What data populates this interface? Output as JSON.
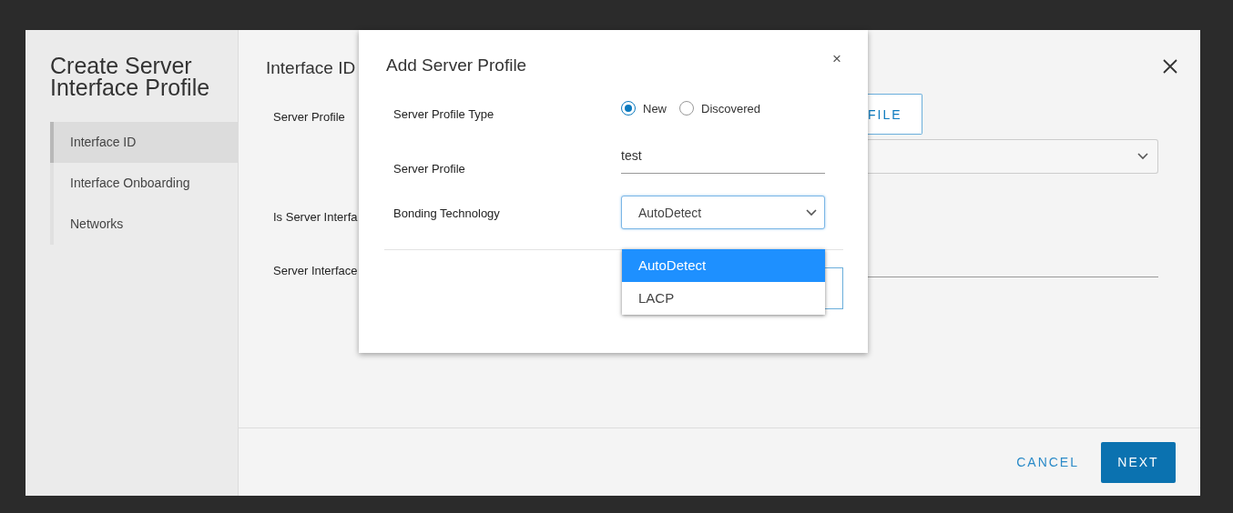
{
  "wizard": {
    "title": "Create Server Interface Profile",
    "steps": [
      {
        "label": "Interface ID",
        "selected": true
      },
      {
        "label": "Interface Onboarding",
        "selected": false
      },
      {
        "label": "Networks",
        "selected": false
      }
    ]
  },
  "form": {
    "title": "Interface ID",
    "server_profile": {
      "label": "Server Profile",
      "button": "FILE"
    },
    "discovered": {
      "label": "Is Server Interfa"
    },
    "interface_id": {
      "label": "Server Interface"
    }
  },
  "footer": {
    "cancel": "CANCEL",
    "next": "NEXT"
  },
  "dialog": {
    "title": "Add Server Profile",
    "close": "×",
    "type": {
      "label": "Server Profile Type",
      "options": [
        {
          "label": "New",
          "selected": true
        },
        {
          "label": "Discovered",
          "selected": false
        }
      ]
    },
    "profile": {
      "label": "Server Profile",
      "value": "test"
    },
    "bonding": {
      "label": "Bonding Technology",
      "value": "AutoDetect",
      "expanded": true,
      "options": [
        {
          "label": "AutoDetect",
          "selected": true
        },
        {
          "label": "LACP",
          "selected": false
        }
      ]
    }
  }
}
